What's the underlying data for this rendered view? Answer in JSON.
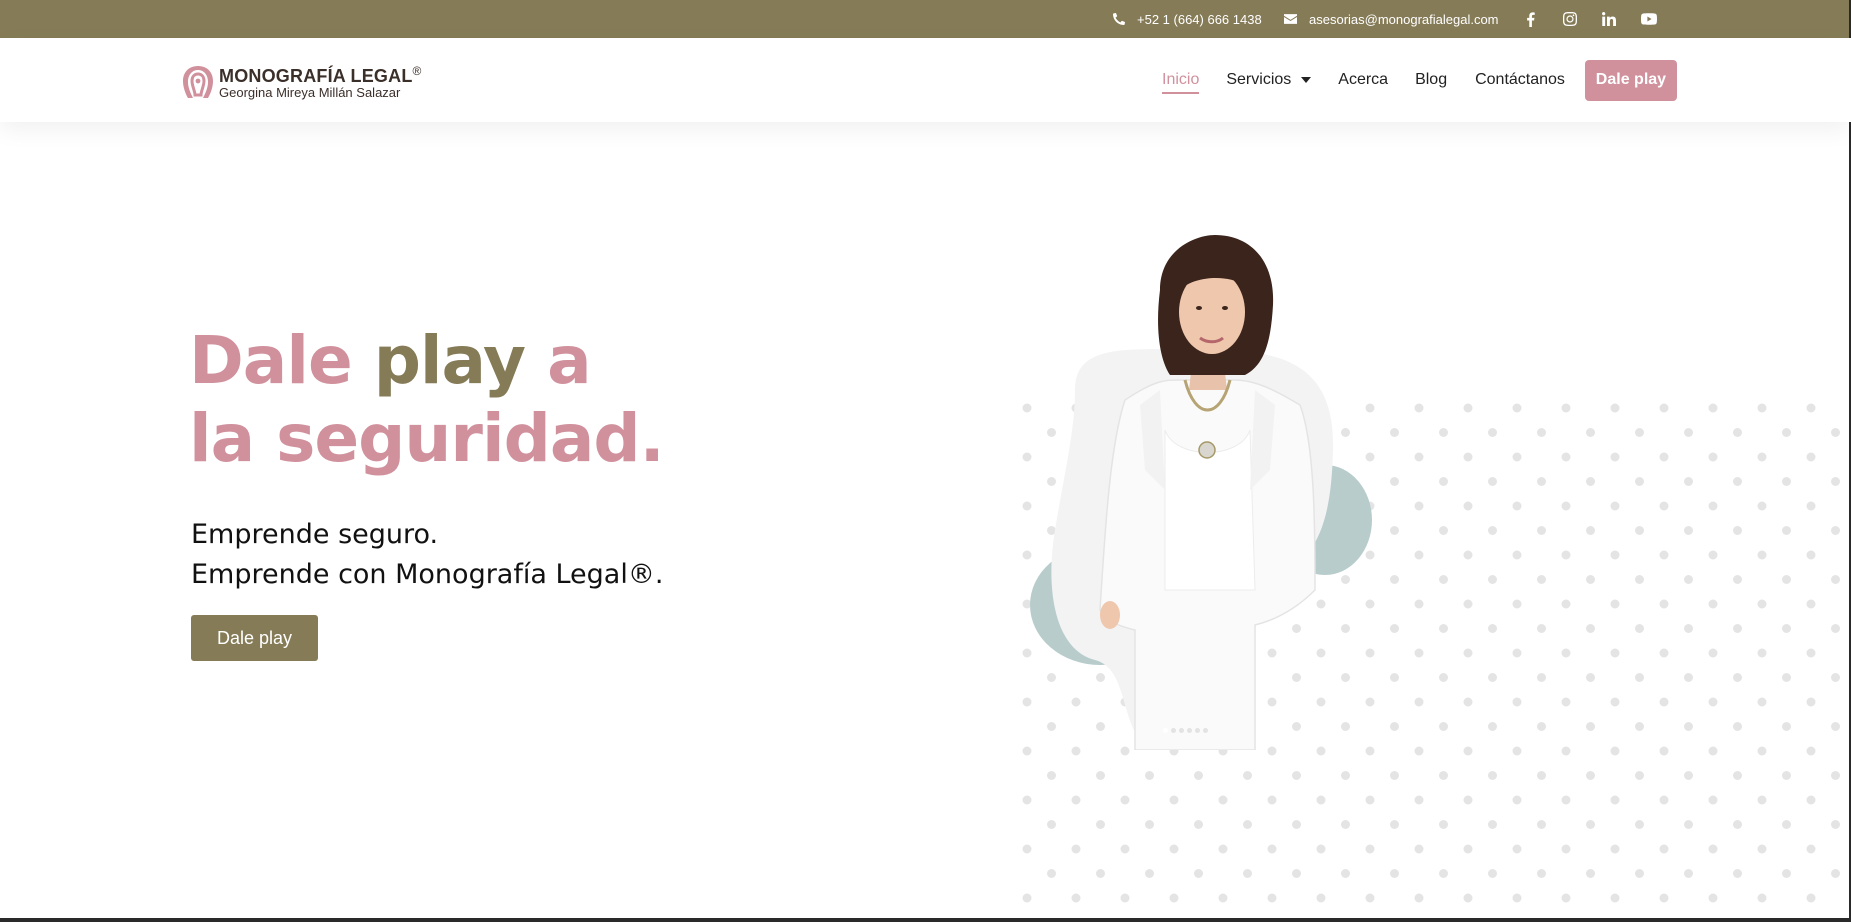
{
  "topbar": {
    "phone": "+52 1 (664) 666 1438",
    "email": "asesorias@monografialegal.com",
    "social": [
      "facebook-icon",
      "instagram-icon",
      "linkedin-icon",
      "youtube-icon"
    ]
  },
  "brand": {
    "title": "MONOGRAFÍA LEGAL",
    "registered": "®",
    "subtitle": "Georgina Mireya Millán Salazar"
  },
  "nav": {
    "items": [
      {
        "label": "Inicio",
        "active": true
      },
      {
        "label": "Servicios",
        "has_dropdown": true
      },
      {
        "label": "Acerca"
      },
      {
        "label": "Blog"
      },
      {
        "label": "Contáctanos"
      }
    ],
    "cta_label": "Dale play"
  },
  "hero": {
    "title_part1": "Dale ",
    "title_accent": "play",
    "title_part2": " a",
    "title_line2": "la seguridad.",
    "subtitle_line1": "Emprende seguro.",
    "subtitle_line2": "Emprende con Monografía Legal®.",
    "cta_label": "Dale play",
    "carousel_slide_count": 6,
    "carousel_active_index": 0
  },
  "colors": {
    "brand_olive": "#857b57",
    "brand_pink": "#d0919d",
    "blob_teal": "#b8cccc"
  }
}
